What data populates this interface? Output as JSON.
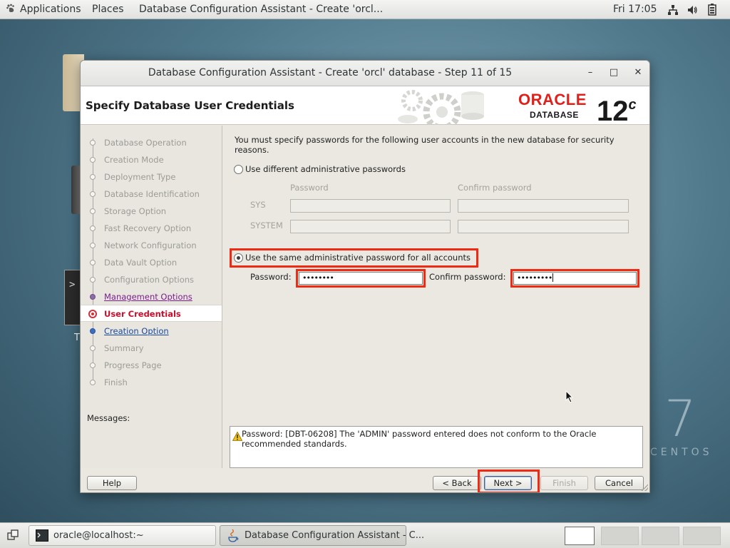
{
  "topbar": {
    "applications": "Applications",
    "places": "Places",
    "active_window": "Database Configuration Assistant - Create 'orcl...",
    "clock": "Fri 17:05"
  },
  "desktop": {
    "partial_label": "T",
    "brand_number": "7",
    "brand_word": "CENTOS"
  },
  "window": {
    "title": "Database Configuration Assistant - Create 'orcl' database - Step 11 of 15",
    "minimize": "–",
    "maximize": "□",
    "close": "✕"
  },
  "header": {
    "title": "Specify Database User Credentials",
    "logo_word": "ORACLE",
    "logo_sub": "DATABASE",
    "version": "12",
    "version_sup": "c"
  },
  "nav": {
    "items": [
      {
        "label": "Database Operation",
        "state": "done"
      },
      {
        "label": "Creation Mode",
        "state": "done"
      },
      {
        "label": "Deployment Type",
        "state": "done"
      },
      {
        "label": "Database Identification",
        "state": "done"
      },
      {
        "label": "Storage Option",
        "state": "done"
      },
      {
        "label": "Fast Recovery Option",
        "state": "done"
      },
      {
        "label": "Network Configuration",
        "state": "done"
      },
      {
        "label": "Data Vault Option",
        "state": "done"
      },
      {
        "label": "Configuration Options",
        "state": "done"
      },
      {
        "label": "Management Options",
        "state": "visited"
      },
      {
        "label": "User Credentials",
        "state": "current"
      },
      {
        "label": "Creation Option",
        "state": "next"
      },
      {
        "label": "Summary",
        "state": "pending"
      },
      {
        "label": "Progress Page",
        "state": "pending"
      },
      {
        "label": "Finish",
        "state": "pending"
      }
    ]
  },
  "content": {
    "intro": "You must specify passwords for the following user accounts in the new database for security reasons.",
    "option_different": "Use different administrative passwords",
    "option_different_checked": false,
    "col_password": "Password",
    "col_confirm": "Confirm password",
    "row_sys": "SYS",
    "row_system": "SYSTEM",
    "option_same": "Use the same administrative password for all accounts",
    "option_same_checked": true,
    "password_label": "Password:",
    "password_value": "••••••••",
    "confirm_label": "Confirm password:",
    "confirm_value": "•••••••••"
  },
  "messages": {
    "label": "Messages:",
    "text": "Password: [DBT-06208] The 'ADMIN' password entered does not conform to the Oracle recommended standards."
  },
  "buttons": {
    "help": "Help",
    "back": "< Back",
    "next": "Next >",
    "finish": "Finish",
    "cancel": "Cancel"
  },
  "taskbar": {
    "tasks": [
      {
        "label": "oracle@localhost:~",
        "active": false
      },
      {
        "label": "Database Configuration Assistant - C...",
        "active": true
      }
    ]
  },
  "colors": {
    "highlight": "#ee2a15",
    "oracle_red": "#e0201b",
    "current_step": "#c8102e"
  }
}
